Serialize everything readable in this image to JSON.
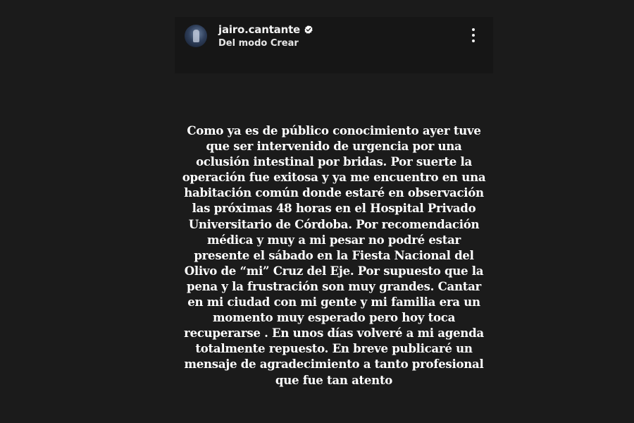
{
  "header": {
    "username": "jairo.cantante",
    "subtitle": "Del modo Crear",
    "avatar_icon": "profile-avatar-performer",
    "verified_icon": "verified-badge-icon",
    "menu_icon": "more-vertical-icon"
  },
  "story": {
    "text": "Como ya es de público conocimiento ayer tuve que ser intervenido de urgencia por una oclusión intestinal por bridas. Por suerte la operación fue exitosa y ya me encuentro en una habitación común donde estaré en observación las próximas 48 horas en el Hospital Privado Universitario de Córdoba. Por recomendación médica y muy a mi pesar no podré estar presente el sábado en la Fiesta Nacional del Olivo de “mi” Cruz del Eje. Por supuesto que la pena y la frustración son muy grandes. Cantar en mi ciudad con mi gente y mi familia era un momento muy esperado pero hoy toca recuperarse . En unos días volveré a mi agenda totalmente repuesto. En breve publicaré un mensaje de agradecimiento a tanto profesional que fue tan atento"
  },
  "colors": {
    "background": "#1b1b1b",
    "header_background": "#161616",
    "text": "#ffffff",
    "verified": "#ffffff"
  }
}
